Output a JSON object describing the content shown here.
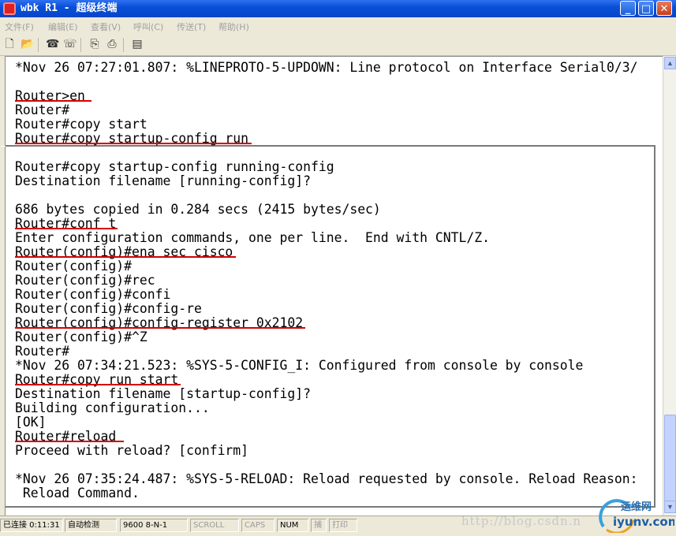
{
  "window": {
    "title": "wbk R1 - 超级终端",
    "buttons": {
      "minimize": "_",
      "maximize": "□",
      "close": "✕"
    }
  },
  "menu": [
    {
      "label": "文件(F)"
    },
    {
      "label": "编辑(E)"
    },
    {
      "label": "查看(V)"
    },
    {
      "label": "呼叫(C)"
    },
    {
      "label": "传送(T)"
    },
    {
      "label": "帮助(H)"
    }
  ],
  "toolbar": {
    "icons": [
      "new-icon",
      "open-icon",
      "disconnect-icon",
      "connect-icon",
      "send-icon",
      "receive-icon",
      "properties-icon"
    ]
  },
  "terminal": {
    "lines": [
      "*Nov 26 07:27:01.807: %LINEPROTO-5-UPDOWN: Line protocol on Interface Serial0/3/",
      "",
      "Router>en",
      "Router#",
      "Router#copy start",
      "Router#copy startup-config run",
      "",
      "Router#copy startup-config running-config",
      "Destination filename [running-config]?",
      "",
      "686 bytes copied in 0.284 secs (2415 bytes/sec)",
      "Router#conf t",
      "Enter configuration commands, one per line.  End with CNTL/Z.",
      "Router(config)#ena sec cisco",
      "Router(config)#",
      "Router(config)#rec",
      "Router(config)#confi",
      "Router(config)#config-re",
      "Router(config)#config-register 0x2102",
      "Router(config)#^Z",
      "Router#",
      "*Nov 26 07:34:21.523: %SYS-5-CONFIG_I: Configured from console by console",
      "Router#copy run start",
      "Destination filename [startup-config]?",
      "Building configuration...",
      "[OK]",
      "Router#reload",
      "Proceed with reload? [confirm]",
      "",
      "*Nov 26 07:35:24.487: %SYS-5-RELOAD: Reload requested by console. Reload Reason:",
      " Reload Command."
    ]
  },
  "statusbar": {
    "connection": "已连接 0:11:31",
    "detect": "自动检测",
    "params": "9600 8-N-1",
    "scroll": "SCROLL",
    "caps": "CAPS",
    "num": "NUM",
    "capture": "捕",
    "print": "打印"
  },
  "watermark": {
    "url": "http://blog.csdn.n",
    "logo_cn": "运维网",
    "logo_en": "iyunv.com"
  },
  "colors": {
    "titlebar": "#0a4fd8",
    "underline": "#d40000",
    "terminal_bg": "#ffffff",
    "chrome": "#ece9d8"
  }
}
